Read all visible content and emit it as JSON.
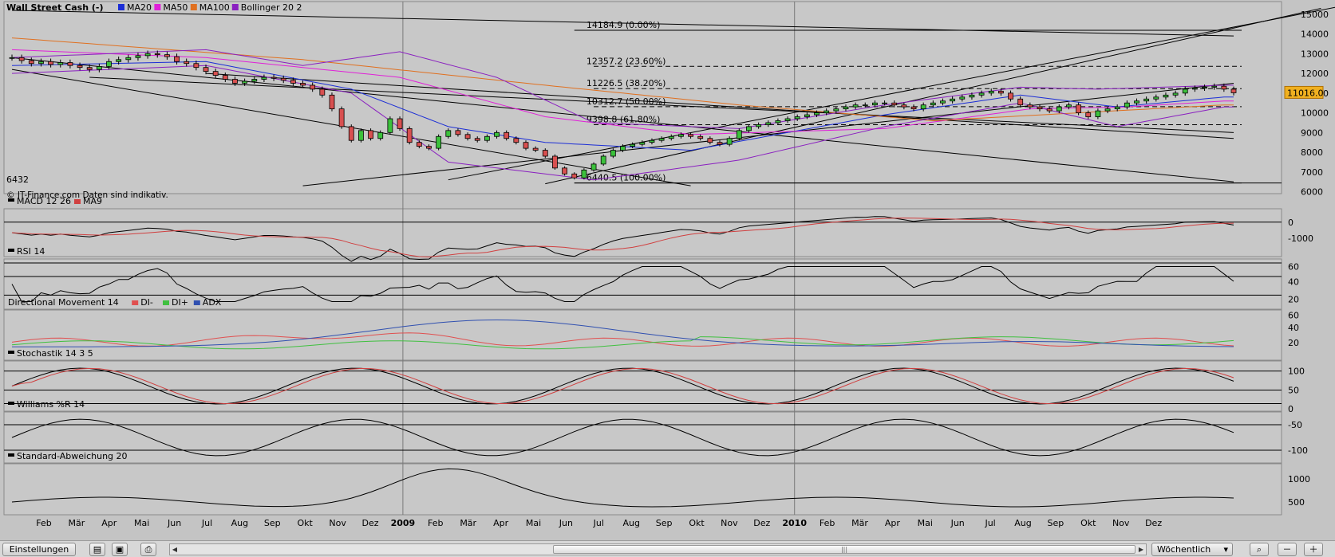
{
  "chart_data": {
    "type": "line",
    "instrument": "Wall Street Cash (-)",
    "legend": [
      {
        "name": "Wall Street Cash (-)",
        "color": "#000000"
      },
      {
        "name": "MA20",
        "color": "#1c2ed6"
      },
      {
        "name": "MA50",
        "color": "#e020d8"
      },
      {
        "name": "MA100",
        "color": "#e07020"
      },
      {
        "name": "Bollinger 20 2",
        "color": "#8a20c0"
      }
    ],
    "y_axis": {
      "ticks": [
        "15000",
        "14000",
        "13000",
        "12000",
        "11000",
        "10000",
        "9000",
        "8000",
        "7000",
        "6000"
      ],
      "range": [
        5900,
        15400
      ]
    },
    "x_axis": {
      "labels": [
        "Feb",
        "Mär",
        "Apr",
        "Mai",
        "Jun",
        "Jul",
        "Aug",
        "Sep",
        "Okt",
        "Nov",
        "Dez",
        "2009",
        "Feb",
        "Mär",
        "Apr",
        "Mai",
        "Jun",
        "Jul",
        "Aug",
        "Sep",
        "Okt",
        "Nov",
        "Dez",
        "2010",
        "Feb",
        "Mär",
        "Apr",
        "Mai",
        "Jun",
        "Jul",
        "Aug",
        "Sep",
        "Okt",
        "Nov",
        "Dez"
      ]
    },
    "current_value": "11016.0",
    "low_label": "6432",
    "fib_levels": [
      {
        "label": "14184.9 (0.00%)",
        "value": 14184.9
      },
      {
        "label": "12357.2 (23.60%)",
        "value": 12357.2
      },
      {
        "label": "11226.5 (38.20%)",
        "value": 11226.5
      },
      {
        "label": "10312.7 (50.00%)",
        "value": 10312.7
      },
      {
        "label": "9398.8 (61.80%)",
        "value": 9398.8
      },
      {
        "label": "6440.5 (100.00%)",
        "value": 6440.5
      }
    ],
    "price_weekly_close": [
      12800,
      12650,
      12500,
      12600,
      12450,
      12550,
      12400,
      12300,
      12200,
      12350,
      12600,
      12700,
      12800,
      12900,
      13000,
      12950,
      12850,
      12600,
      12500,
      12300,
      12100,
      11900,
      11700,
      11500,
      11600,
      11700,
      11800,
      11750,
      11650,
      11500,
      11400,
      11200,
      10900,
      10200,
      9300,
      8600,
      9100,
      8700,
      9000,
      9700,
      9200,
      8500,
      8300,
      8200,
      8800,
      9100,
      8900,
      8700,
      8600,
      8800,
      9000,
      8700,
      8500,
      8200,
      8100,
      7800,
      7200,
      6900,
      6700,
      7100,
      7400,
      7800,
      8100,
      8300,
      8400,
      8500,
      8600,
      8700,
      8800,
      8900,
      8800,
      8700,
      8500,
      8400,
      8700,
      9100,
      9300,
      9400,
      9500,
      9600,
      9700,
      9800,
      9900,
      10000,
      10100,
      10200,
      10300,
      10400,
      10400,
      10500,
      10500,
      10400,
      10300,
      10200,
      10400,
      10500,
      10600,
      10700,
      10800,
      10900,
      11000,
      11100,
      11000,
      10700,
      10400,
      10300,
      10200,
      10100,
      10300,
      10400,
      10000,
      9800,
      10100,
      10200,
      10300,
      10500,
      10600,
      10700,
      10800,
      10900,
      11000,
      11200,
      11250,
      11300,
      11350,
      11200,
      11016
    ],
    "ma_hints": {
      "MA20": [
        [
          0,
          12400
        ],
        [
          20,
          12600
        ],
        [
          35,
          11200
        ],
        [
          45,
          9300
        ],
        [
          55,
          8500
        ],
        [
          70,
          8100
        ],
        [
          90,
          9900
        ],
        [
          104,
          10900
        ],
        [
          114,
          10300
        ],
        [
          125,
          10800
        ]
      ],
      "MA50": [
        [
          0,
          13200
        ],
        [
          20,
          12800
        ],
        [
          40,
          11800
        ],
        [
          55,
          9800
        ],
        [
          70,
          8900
        ],
        [
          90,
          9200
        ],
        [
          105,
          10200
        ],
        [
          115,
          10300
        ],
        [
          125,
          10600
        ]
      ],
      "MA100": [
        [
          0,
          13800
        ],
        [
          30,
          12700
        ],
        [
          55,
          11400
        ],
        [
          75,
          10400
        ],
        [
          95,
          9600
        ],
        [
          110,
          10000
        ],
        [
          125,
          10400
        ]
      ],
      "Bollinger upper": [
        [
          0,
          12800
        ],
        [
          20,
          13200
        ],
        [
          30,
          12400
        ],
        [
          40,
          13100
        ],
        [
          50,
          11800
        ],
        [
          60,
          9500
        ],
        [
          75,
          9200
        ],
        [
          90,
          10400
        ],
        [
          104,
          11300
        ],
        [
          112,
          11200
        ],
        [
          125,
          11400
        ]
      ],
      "Bollinger lower": [
        [
          0,
          12000
        ],
        [
          20,
          12400
        ],
        [
          35,
          11000
        ],
        [
          45,
          7500
        ],
        [
          60,
          6600
        ],
        [
          75,
          7600
        ],
        [
          90,
          9300
        ],
        [
          104,
          10500
        ],
        [
          114,
          9300
        ],
        [
          125,
          10300
        ]
      ]
    },
    "copyright": "© IT-Finance.com Daten sind indikativ.",
    "indicators": [
      {
        "title": "MACD 12 26",
        "series": [
          {
            "name": "MACD 12 26",
            "color": "#000000"
          },
          {
            "name": "MA9",
            "color": "#d04040"
          }
        ],
        "ticks": [
          "0",
          "-1000"
        ]
      },
      {
        "title": "RSI 14",
        "series": [
          {
            "name": "RSI 14",
            "color": "#000000"
          }
        ],
        "ticks": [
          "60",
          "40",
          "20"
        ]
      },
      {
        "title": "Directional Movement 14",
        "series": [
          {
            "name": "DI-",
            "color": "#e05050"
          },
          {
            "name": "DI+",
            "color": "#40c040"
          },
          {
            "name": "ADX",
            "color": "#3050b0"
          }
        ],
        "ticks": [
          "60",
          "40",
          "20"
        ]
      },
      {
        "title": "Stochastik 14 3 5",
        "series": [
          {
            "name": "Stochastik 14 3 5",
            "color": "#000000"
          }
        ],
        "ticks": [
          "100",
          "50",
          "0"
        ]
      },
      {
        "title": "Williams %R 14",
        "series": [
          {
            "name": "Williams %R 14",
            "color": "#000000"
          }
        ],
        "ticks": [
          "-50",
          "-100"
        ]
      },
      {
        "title": "Standard-Abweichung 20",
        "series": [
          {
            "name": "Standard-Abweichung 20",
            "color": "#000000"
          }
        ],
        "ticks": [
          "1000",
          "500"
        ]
      }
    ]
  },
  "toolbar": {
    "settings_label": "Einstellungen",
    "interval_label": "Wöchentlich",
    "icons": [
      "indicators-icon",
      "save-icon",
      "print-icon",
      "scroll-left-icon",
      "scroll-right-icon",
      "zoom-fit-icon",
      "zoom-out-icon",
      "zoom-in-icon"
    ]
  }
}
